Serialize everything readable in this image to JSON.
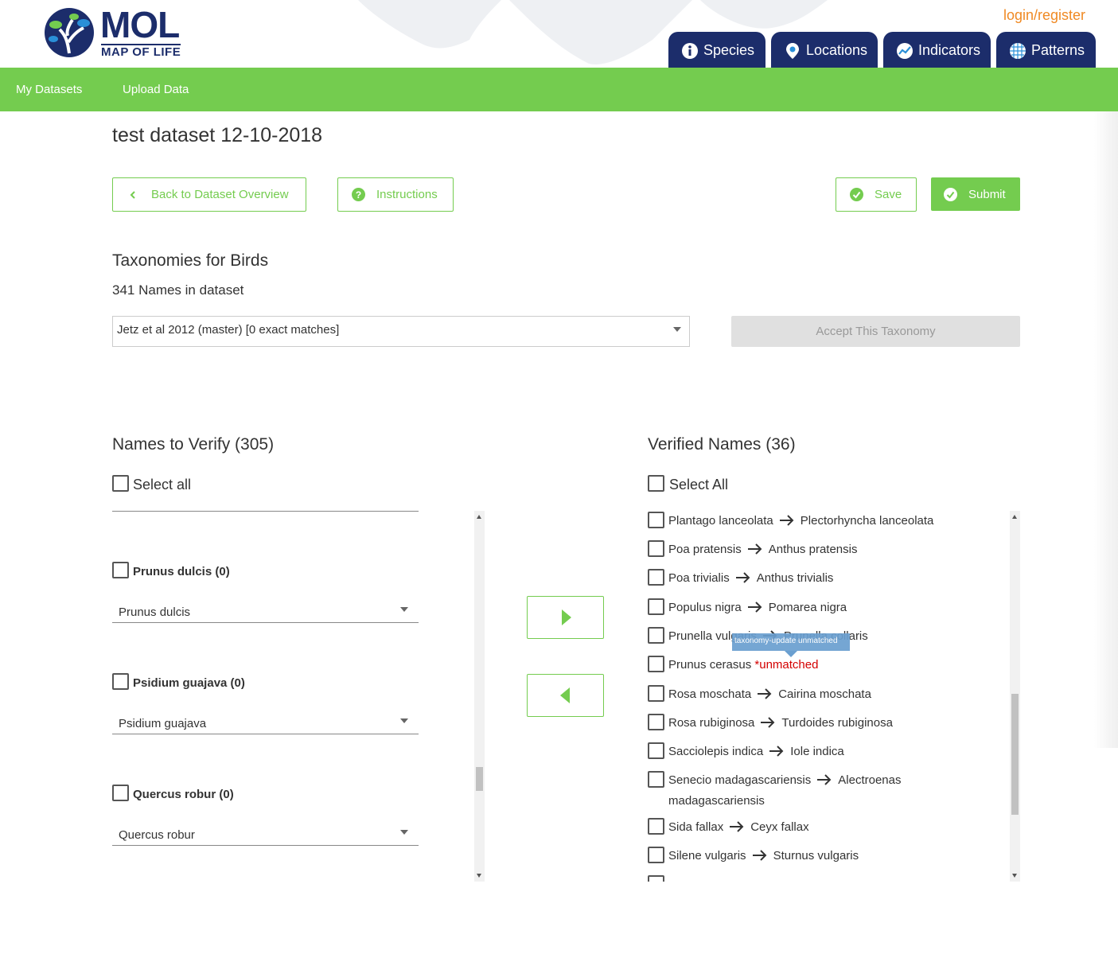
{
  "header": {
    "logo_title": "MOL",
    "logo_subtitle": "MAP OF LIFE",
    "login_label": "login/register",
    "nav_tabs": [
      {
        "label": "Species",
        "icon": "info-icon"
      },
      {
        "label": "Locations",
        "icon": "location-pin-icon"
      },
      {
        "label": "Indicators",
        "icon": "chart-icon"
      },
      {
        "label": "Patterns",
        "icon": "globe-grid-icon"
      }
    ]
  },
  "subnav": {
    "items": [
      "My Datasets",
      "Upload Data"
    ]
  },
  "page": {
    "title": "test dataset 12-10-2018"
  },
  "toolbar": {
    "back_label": "Back to Dataset Overview",
    "instructions_label": "Instructions",
    "save_label": "Save",
    "submit_label": "Submit"
  },
  "taxonomy": {
    "section_title": "Taxonomies for Birds",
    "names_count": "341 Names in dataset",
    "selected": "Jetz et al 2012 (master) [0 exact matches]",
    "accept_label": "Accept This Taxonomy"
  },
  "to_verify": {
    "title": "Names to Verify (305)",
    "select_all": "Select all",
    "items": [
      {
        "label": "Prunus dulcis (0)",
        "selected": "Prunus dulcis"
      },
      {
        "label": "Psidium guajava (0)",
        "selected": "Psidium guajava"
      },
      {
        "label": "Quercus robur (0)",
        "selected": "Quercus robur"
      }
    ]
  },
  "verified": {
    "title": "Verified Names (36)",
    "select_all": "Select All",
    "tooltip": "taxonomy-update unmatched",
    "items": [
      {
        "from": "Plantago lanceolata",
        "to": "Plectorhyncha lanceolata"
      },
      {
        "from": "Poa pratensis",
        "to": "Anthus pratensis"
      },
      {
        "from": "Poa trivialis",
        "to": "Anthus trivialis"
      },
      {
        "from": "Populus nigra",
        "to": "Pomarea nigra"
      },
      {
        "from": "Prunella vulgaris",
        "to": "Prunella collaris"
      },
      {
        "from": "Prunus cerasus",
        "to": "*unmatched"
      },
      {
        "from": "Rosa moschata",
        "to": "Cairina moschata"
      },
      {
        "from": "Rosa rubiginosa",
        "to": "Turdoides rubiginosa"
      },
      {
        "from": "Sacciolepis indica",
        "to": "Iole indica"
      },
      {
        "from": "Senecio madagascariensis",
        "to": "Alectroenas madagascariensis"
      },
      {
        "from": "Sida fallax",
        "to": "Ceyx fallax"
      },
      {
        "from": "Silene vulgaris",
        "to": "Sturnus vulgaris"
      }
    ]
  },
  "colors": {
    "brand_navy": "#1c2d6b",
    "accent_green": "#74cc4f",
    "login_orange": "#f08a24",
    "unmatched_red": "#d40000"
  }
}
